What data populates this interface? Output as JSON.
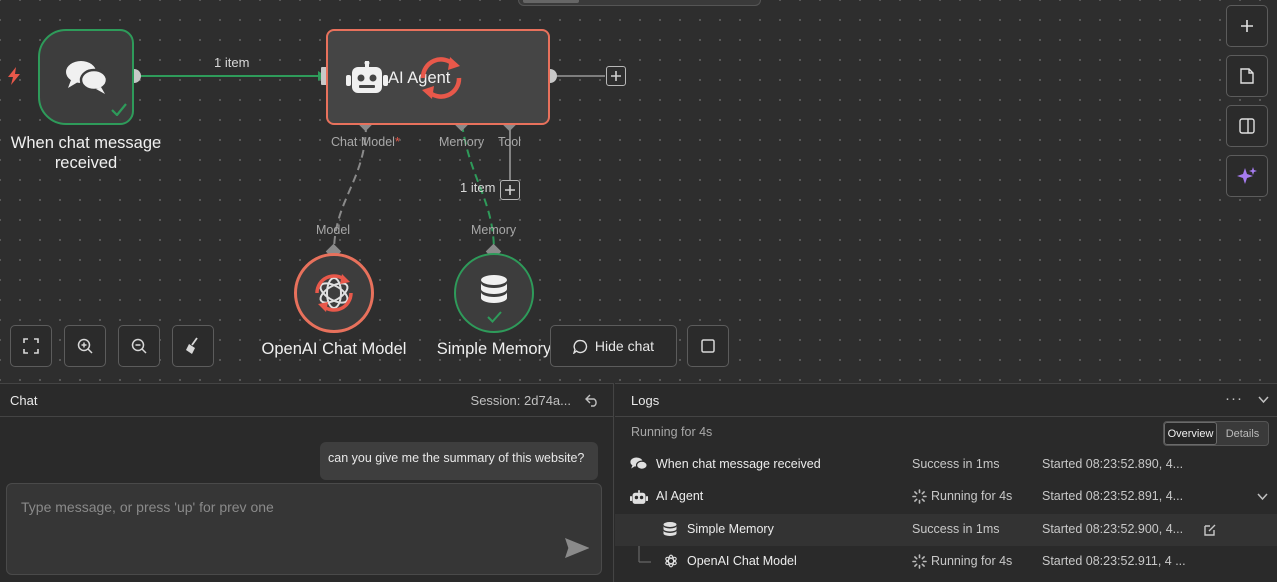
{
  "canvas": {
    "edge_trigger_agent_label": "1 item",
    "edge_memory_label": "1 item",
    "nodes": {
      "trigger": {
        "title_line1": "When chat message",
        "title_line2": "received"
      },
      "agent": {
        "title": "AI Agent"
      },
      "openai": {
        "title": "OpenAI Chat Model"
      },
      "memory": {
        "title": "Simple Memory"
      }
    },
    "ports": {
      "chat_model": "Chat Model",
      "chat_model_required": "*",
      "memory": "Memory",
      "tool": "Tool",
      "model_in": "Model",
      "memory_in": "Memory"
    },
    "controls": {
      "hide_chat_label": "Hide chat"
    }
  },
  "chat": {
    "title": "Chat",
    "session_label": "Session: 2d74a...",
    "messages": [
      "can you give me the summary of this website?"
    ],
    "input_placeholder": "Type message, or press 'up' for prev one"
  },
  "logs": {
    "title": "Logs",
    "running_for": "Running for 4s",
    "view_toggle": {
      "overview": "Overview",
      "details": "Details",
      "active": "overview"
    },
    "rows": [
      {
        "name": "When chat message received",
        "status": "Success in 1ms",
        "started": "Started 08:23:52.890, 4...",
        "icon": "chat-bubbles-icon"
      },
      {
        "name": "AI Agent",
        "status": "Running for 4s",
        "started": "Started 08:23:52.891, 4...",
        "icon": "robot-icon"
      },
      {
        "name": "Simple Memory",
        "status": "Success in 1ms",
        "started": "Started 08:23:52.900, 4...",
        "icon": "database-icon"
      },
      {
        "name": "OpenAI Chat Model",
        "status": "Running for 4s",
        "started": "Started 08:23:52.911, 4 ...",
        "icon": "openai-icon"
      }
    ]
  },
  "colors": {
    "success": "#2e9b5a",
    "running": "#e8715c",
    "ai_accent": "#a67cf0"
  }
}
